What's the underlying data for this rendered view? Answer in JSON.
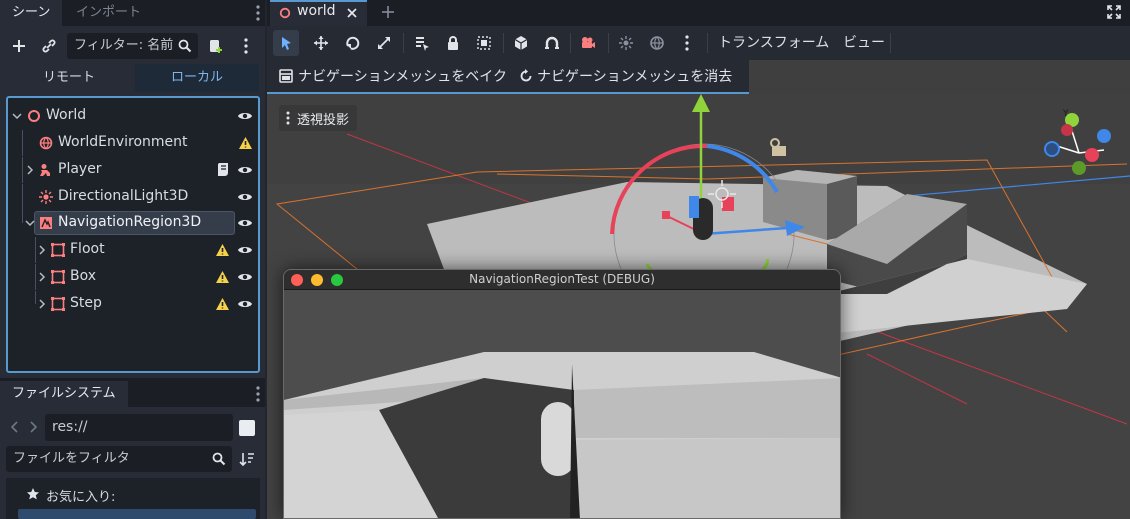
{
  "scene_dock": {
    "tabs": [
      {
        "label": "シーン",
        "active": true
      },
      {
        "label": "インポート",
        "active": false
      }
    ],
    "filter_placeholder": "フィルター: 名前",
    "segment": {
      "remote": "リモート",
      "local": "ローカル"
    },
    "nodes": [
      {
        "label": "World",
        "icon": "node3d-icon",
        "depth": 0,
        "expanded": true,
        "warning": false,
        "script": false,
        "visible": true,
        "selected": false
      },
      {
        "label": "WorldEnvironment",
        "icon": "world-environment-icon",
        "depth": 1,
        "warning": true,
        "script": false,
        "visible": false,
        "selected": false
      },
      {
        "label": "Player",
        "icon": "character-icon",
        "depth": 1,
        "collapsed": true,
        "warning": false,
        "script": true,
        "visible": true,
        "selected": false
      },
      {
        "label": "DirectionalLight3D",
        "icon": "sun-icon",
        "depth": 1,
        "warning": false,
        "script": false,
        "visible": true,
        "selected": false
      },
      {
        "label": "NavigationRegion3D",
        "icon": "navigation-region-icon",
        "depth": 1,
        "expanded": true,
        "warning": false,
        "script": false,
        "visible": true,
        "selected": true
      },
      {
        "label": "Floot",
        "icon": "static-body-icon",
        "depth": 2,
        "collapsed": true,
        "warning": true,
        "script": false,
        "visible": true,
        "selected": false
      },
      {
        "label": "Box",
        "icon": "static-body-icon",
        "depth": 2,
        "collapsed": true,
        "warning": true,
        "script": false,
        "visible": true,
        "selected": false
      },
      {
        "label": "Step",
        "icon": "static-body-icon",
        "depth": 2,
        "collapsed": true,
        "warning": true,
        "script": false,
        "visible": true,
        "selected": false
      }
    ]
  },
  "file_dock": {
    "title": "ファイルシステム",
    "path": "res://",
    "filter_placeholder": "ファイルをフィルタ",
    "favorites_label": "お気に入り:"
  },
  "editor": {
    "tab_label": "world",
    "toolbar": {
      "transform_menu": "トランスフォーム",
      "view_menu": "ビュー"
    },
    "bake_button": "ナビゲーションメッシュをベイク",
    "clear_button": "ナビゲーションメッシュを消去",
    "viewport_menu": "透視投影",
    "debug_window_title": "NavigationRegionTest (DEBUG)"
  },
  "colors": {
    "accent": "#5899d0",
    "warning": "#f5d24a",
    "node_red": "#fc7f7f",
    "x_axis": "#e8415a",
    "y_axis": "#8fd43a",
    "z_axis": "#3f87e8",
    "navmesh_outline": "#d8732e"
  }
}
